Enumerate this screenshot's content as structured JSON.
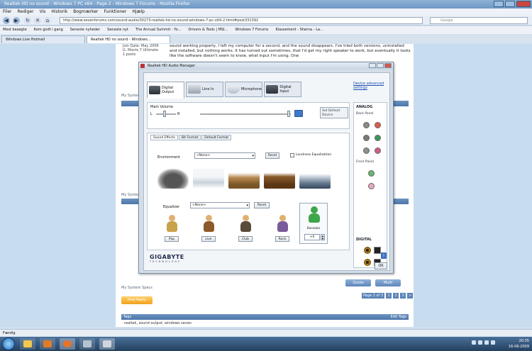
{
  "window": {
    "title": "Realtek HD no sound - Windows 7 PC x64 - Page 2 - Windows 7 Forums - Mozilla Firefox"
  },
  "menu": [
    "Filer",
    "Rediger",
    "Vis",
    "Historik",
    "Bogmærker",
    "Funktioner",
    "Hjælp"
  ],
  "nav": {
    "url": "http://www.sevenforums.com/sound-audio/30273-realtek-hd-no-sound-windows-7-pc-x64-2.html#post331392",
    "search_placeholder": "Google"
  },
  "bookmarks": [
    "Mest besøgte",
    "Kom godt i gang",
    "Seneste nyheder",
    "Seneste nyt",
    "The Annual Summit - Yo...",
    "Drivers & Tools | MSI...",
    "Windows 7 Forums",
    "Klassement - Sherna - La..."
  ],
  "tabs": [
    "Windows Live Hotmail",
    "Realtek HD no sound - Windows..."
  ],
  "forum": {
    "joined": "Join Date: May 2009",
    "location": "G. Monts 7 Ultimate",
    "posts": "1 posts",
    "post_text": "sound working properly, I left my computer for a second, and the sound disappears. I've tried both versions, uninstalled and installed, but nothing works. It has turned out sometimes, that I'd get my right speaker to work, but eventually it looks like the software doesn't seem to know, what input I'm using. One",
    "my_system": "My System",
    "my_system_2": "My System Specs",
    "quote_label": "Quote",
    "multi_label": "Multi",
    "pager": [
      "Page 2 of 3",
      "1",
      "2",
      "3",
      ">"
    ],
    "post_reply": "Post Reply",
    "tags_header": "Tags",
    "edit_tags": "Edit Tags",
    "tags": "realtek, sound output, windows seven"
  },
  "dialog": {
    "title": "Realtek HD Audio Manager",
    "device_tabs": [
      "Digital Output",
      "Line In",
      "Microphone",
      "Digital Input"
    ],
    "advanced_link": "Device advanced settings",
    "main_volume": "Main Volume",
    "left": "L",
    "right": "R",
    "set_default": "Set Default Device",
    "sub_tabs": [
      "Sound Effects",
      "Bit Format",
      "Default Format"
    ],
    "environment_label": "Environment",
    "environment_value": "<None>",
    "reset": "Reset",
    "loudness": "Loudness Equalization",
    "equalizer_label": "Equalizer",
    "equalizer_value": "<None>",
    "presets": [
      "Pop",
      "Live",
      "Club",
      "Rock"
    ],
    "karaoke": "Karaoke",
    "karaoke_value": "+0",
    "analog_title": "ANALOG",
    "back_panel": "Back Panel",
    "front_panel": "Front Panel",
    "digital_title": "DIGITAL",
    "brand": "GIGABYTE",
    "brand_sub": "TECHNOLOGY",
    "ok": "OK",
    "jack_colors": [
      "#8a8a8a",
      "#e05a4a",
      "#7a7a7a",
      "#3a9a5a",
      "#8f8f8f",
      "#d45a8a",
      "#69b86e",
      "#e9a7c2"
    ]
  },
  "status": "Færdig",
  "tray": {
    "time": "20:35",
    "date": "16-06-2009"
  }
}
